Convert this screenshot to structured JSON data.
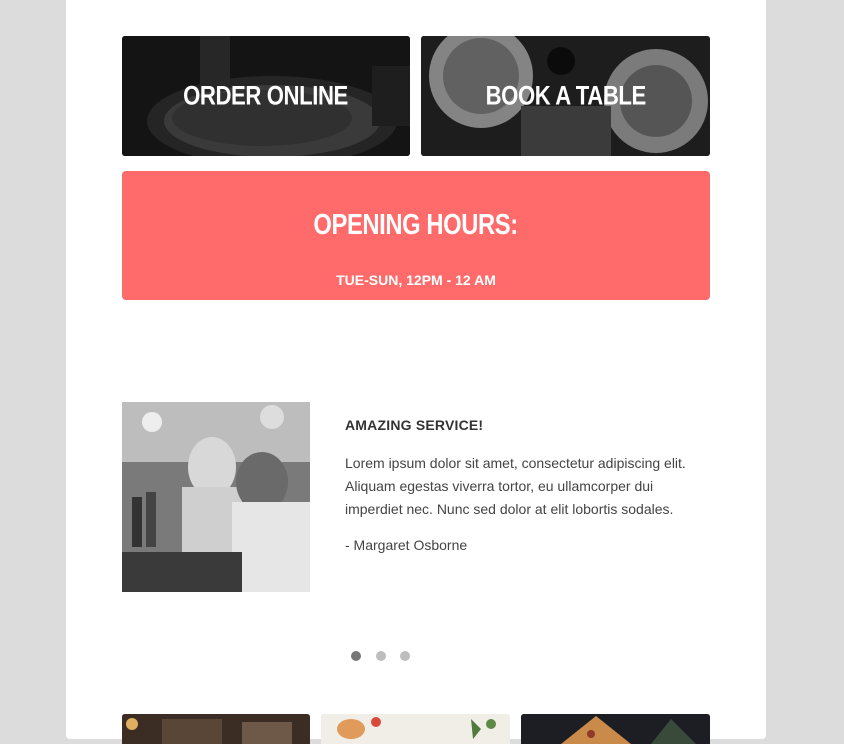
{
  "tiles": {
    "order_online": "ORDER ONLINE",
    "book_table": "BOOK A TABLE"
  },
  "hours": {
    "title": "OPENING HOURS:",
    "time": "TUE-SUN, 12PM - 12 AM"
  },
  "testimonial": {
    "heading": "AMAZING SERVICE!",
    "body": "Lorem ipsum dolor sit amet, consectetur adipiscing elit. Aliquam egestas viverra tortor, eu ullamcorper dui imperdiet nec. Nunc sed dolor at elit lobortis sodales.",
    "author": "- Margaret Osborne"
  },
  "carousel": {
    "slide_count": 3,
    "active_index": 0
  },
  "colors": {
    "accent": "#ff6b6b",
    "page_bg": "#dcdcdc",
    "card_bg": "#ffffff"
  }
}
